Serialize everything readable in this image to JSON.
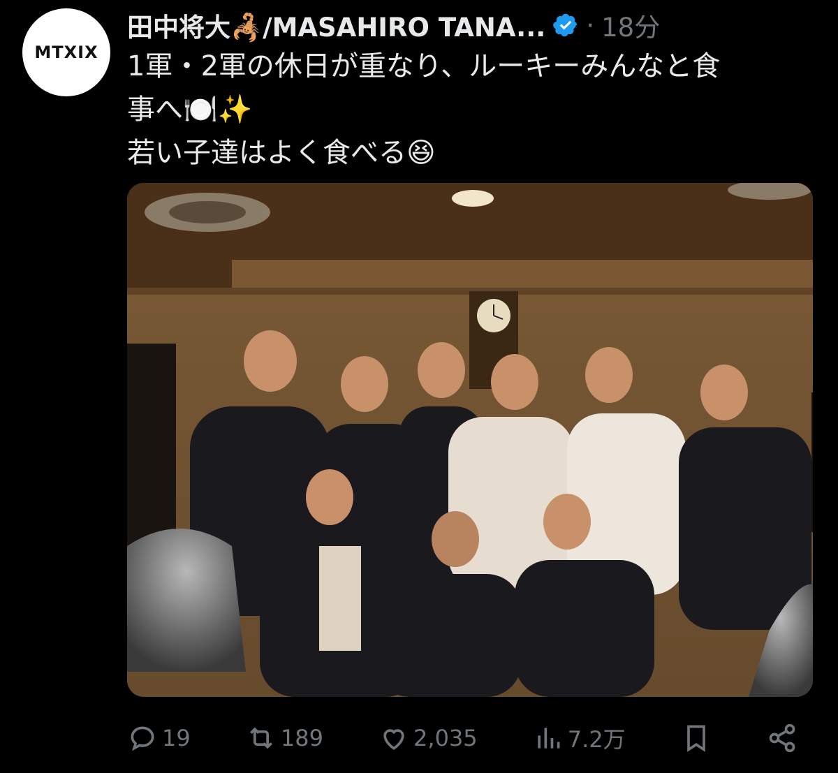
{
  "author": {
    "avatar_text": "MTXIX",
    "name": "田中将大🦂/MASAHIRO TANA...",
    "verified_icon": "verified-badge-icon",
    "separator": "·",
    "time": "18分"
  },
  "tweet": {
    "lines": [
      "1軍・2軍の休日が重なり、ルーキーみんなと食",
      "事へ🍽️✨",
      "若い子達はよく食べる😆"
    ]
  },
  "media": {
    "type": "photo"
  },
  "actions": {
    "reply": {
      "icon": "reply-icon",
      "count": "19"
    },
    "retweet": {
      "icon": "retweet-icon",
      "count": "189"
    },
    "like": {
      "icon": "heart-icon",
      "count": "2,035"
    },
    "views": {
      "icon": "views-icon",
      "count": "7.2万"
    },
    "bookmark": {
      "icon": "bookmark-icon"
    },
    "share": {
      "icon": "share-icon"
    }
  },
  "colors": {
    "background": "#000000",
    "text": "#e7e9ea",
    "muted": "#71767b",
    "verified": "#1d9bf0"
  }
}
